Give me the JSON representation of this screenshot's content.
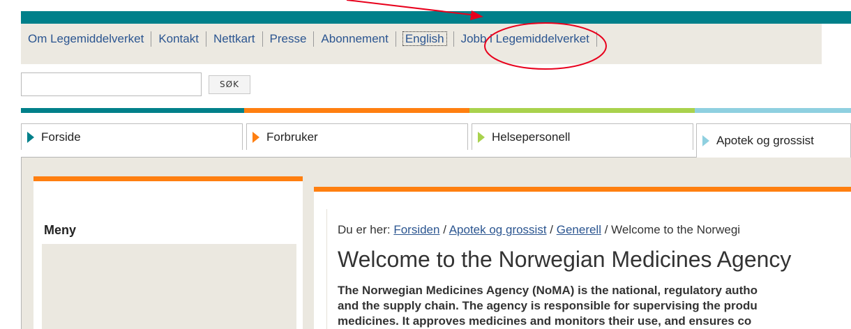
{
  "topnav": {
    "items": [
      "Om Legemiddelverket",
      "Kontakt",
      "Nettkart",
      "Presse",
      "Abonnement",
      "English",
      "Jobb i Legemiddelverket"
    ]
  },
  "search": {
    "button_label": "SØK",
    "value": ""
  },
  "tabs": [
    {
      "label": "Forside"
    },
    {
      "label": "Forbruker"
    },
    {
      "label": "Helsepersonell"
    },
    {
      "label": "Apotek og grossist"
    }
  ],
  "colors": {
    "teal": "#00808a",
    "orange": "#ff7f10",
    "green": "#a9d24d",
    "lightblue": "#8fd0e0",
    "annotation_red": "#e8001c"
  },
  "sidebar": {
    "title": "Meny"
  },
  "breadcrumb": {
    "prefix": "Du er her:",
    "items": [
      "Forsiden",
      "Apotek og grossist",
      "Generell"
    ],
    "current": "Welcome to the Norwegi"
  },
  "main": {
    "title": "Welcome to the Norwegian Medicines Agency",
    "intro_lines": [
      "The Norwegian Medicines Agency (NoMA) is the national, regulatory autho",
      "and the supply chain. The agency is responsible for supervising the produ",
      "medicines. It approves medicines and monitors their use, and ensures co"
    ]
  }
}
